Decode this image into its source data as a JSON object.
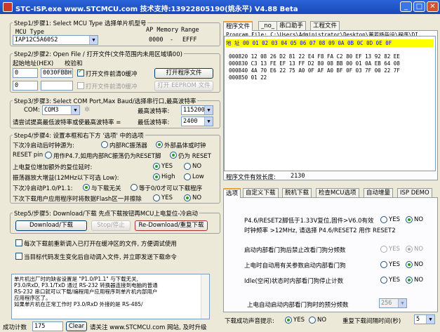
{
  "window": {
    "title": "STC-ISP.exe  www.STCMCU.com  技术支持:13922805190(姚永平)  V4.88 Beta",
    "min": "_",
    "max": "□",
    "close": "✕"
  },
  "step1": {
    "legend": "Step1/步骤1: Select MCU Type  选择单片机型号",
    "mcu_type_label": "MCU Type",
    "ap_memory_label": "AP Memory",
    "range_label": "Range",
    "mcu_value": "IAP12C5A60S2",
    "range_from": "0000",
    "range_dash": "-",
    "range_to": "EFFF"
  },
  "step2": {
    "legend": "Step2/步骤2: Open File / 打开文件(文件范围内未用区域填00)",
    "start_addr_label": "起始地址(HEX)",
    "checksum_label": "校验和",
    "addr1": "0",
    "checksum1": "0030FBBH",
    "clear_buffer1": "打开文件前清0缓冲",
    "open_file_btn": "打开程序文件",
    "addr2": "0",
    "checksum2": "",
    "clear_buffer2": "打开文件前清0缓冲",
    "open_eeprom_btn": "打开 EEPROM 文件"
  },
  "step3": {
    "legend": "Step3/步骤3: Select COM Port,Max Baud/选择串行口,最高波特率",
    "com_label": "COM:",
    "com_value": "COM3",
    "max_baud_label": "最高波特率:",
    "max_baud_value": "115200",
    "min_baud_note": "请尝试提高最低波特率或使最高波特率 =",
    "min_baud_label": "最低波特率:",
    "min_baud_value": "2400"
  },
  "step4": {
    "legend": "Step4/步骤4: 设置本框和右下方 '选项' 中的选项",
    "osc_label": "下次冷启动后时钟源为:",
    "osc_internal": "内部RC振荡器",
    "osc_external": "外部晶体或时钟",
    "reset_label": "RESET pin",
    "reset_p47": "用作P4.7,如用内部RC振荡仍为RESET脚",
    "reset_reset": "仍为 RESET",
    "powerup_label": "上电复位增加额外的复位延时:",
    "yes": "YES",
    "no": "NO",
    "osc_gain_label": "振荡器放大增益(12MHz以下可选 Low):",
    "high": "High",
    "low": "Low",
    "p10_label": "下次冷启动P1.0/P1.1:",
    "p10_opt1": "与下载无关",
    "p10_opt2": "等于0/0才可以下载程序",
    "erase_label": "下次下载用户应用程序时将数据Flash区一并擦除",
    "erase_yes": "YES",
    "erase_no": "NO"
  },
  "step5": {
    "legend": "Step5/步骤5: Download/下载  先点下载按钮再MCU上电复位-冷启动",
    "download_btn": "Download/下载",
    "stop_btn": "Stop/停止",
    "redownload_btn": "Re-Download/重复下载",
    "reload_check": "每次下载前重新调入已打开在缓冲区的文件, 方便调试使用",
    "auto_load_check": "当目标代码发生变化后自动调入文件, 并立即发送下载命令"
  },
  "info_text": [
    "      单片机出厂时的缺省设置是 \"P1.0/P1.1\" 与下载无关,",
    "P3.0/RxD, P3.1/TxD 通过 RS-232 转换器连接到电脑的普通",
    "RS-232 串口就可以下载/编程用户应用程序到单片机内部用户",
    "应用程序区了。",
    "      如果单片机在正常工作时 P3.0/RxD 外接的是 RS-485/"
  ],
  "statusbar": {
    "success_label": "成功计数",
    "success_value": "175",
    "clear_btn": "Clear",
    "notice": "请关注 www.STCMCU.com 网站, 及时升级"
  },
  "right_top": {
    "tabs": [
      "程序文件",
      "_no_",
      "串口助手",
      "工程文件"
    ],
    "program_file_label": "Program File: C:\\Users\\Administrator\\Desktop\\董若扬毕设\\程序\\DI",
    "hex_header": "地 址     00 01 02 03 04 05 06 07 08 09 0A 0B 0C 0D 0E 0F",
    "hex_rows": [
      "000820    12 08 26 D2 81 22 E4 F8 FA C2 80 EF 13 92 82 EE",
      "000830    C3 13 FE EF 13 FF D2 80 08 BB 00 01 0A EB 64 08",
      "000840    4A 70 E6 22 75 A0 0F AF A0 BF 0F 03 7F 00 22 7F",
      "000850    01 22"
    ],
    "valid_length_label": "程序文件有效长度:",
    "valid_length_value": "2130"
  },
  "right_bottom": {
    "tabs": [
      "选项",
      "自定义下载",
      "脱机下载",
      "检查MCU选项",
      "自动增量",
      "ISP DEMO"
    ],
    "opt1_label": "P4.6/RESET2脚低于1.33V复位,固件>V6.0有效",
    "opt1_label2": "时钟频率 >12MHz, 请选择 P4.6/RESET2 用作 RESET2",
    "opt2_label": "启动内部看门狗后禁止改看门狗分频数",
    "opt3_label": "上电时自动用有关参数启动内部看门狗",
    "opt4_label": "Idle(空闲)状态时内部看门狗停止计数",
    "opt5_label": "上电自动启动内部看门狗时的预分频数",
    "opt5_value": "256",
    "yes": "YES",
    "no": "NO",
    "success_prompt_label": "下载成功声音提示:",
    "success_yes": "YES",
    "success_no": "NO",
    "retry_interval_label": "重复下载间隔时间(秒)",
    "retry_interval_value": "5"
  }
}
